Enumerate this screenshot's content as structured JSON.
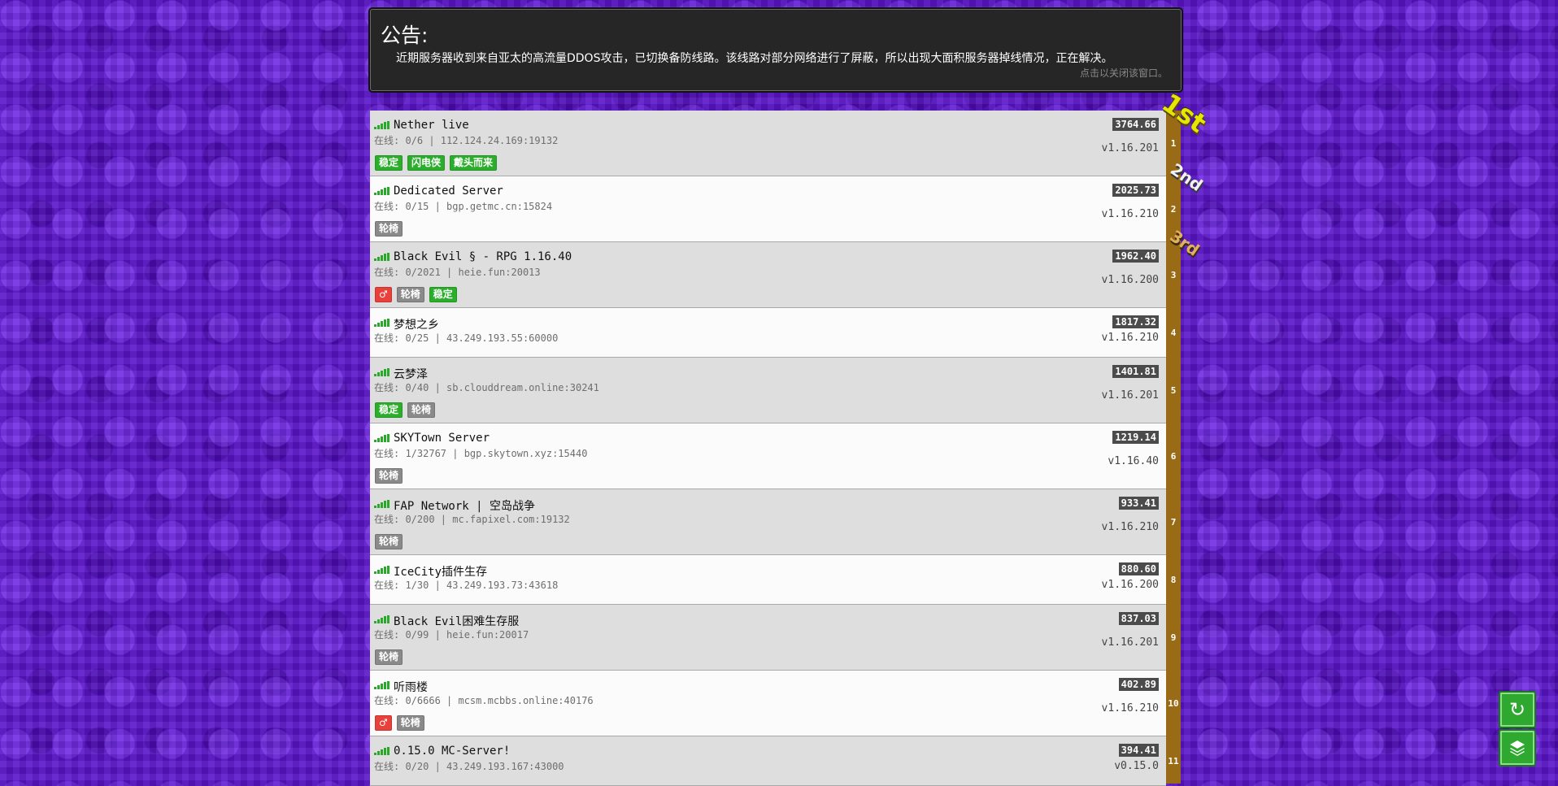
{
  "notice": {
    "title": "公告:",
    "text": "近期服务器收到来自亚太的高流量DDOS攻击，已切换备防线路。该线路对部分网络进行了屏蔽，所以出现大面积服务器掉线情况，正在解决。",
    "close_hint": "点击以关闭该窗口。"
  },
  "medals": {
    "first": "1st",
    "second": "2nd",
    "third": "3rd"
  },
  "servers": [
    {
      "rank": "1",
      "name": "Nether live",
      "online": "在线: 0/6 | 112.124.24.169:19132",
      "score": "3764.66",
      "version": "v1.16.201",
      "tags": [
        [
          "稳定",
          "green"
        ],
        [
          "闪电侠",
          "green"
        ],
        [
          "戴头而来",
          "green"
        ]
      ]
    },
    {
      "rank": "2",
      "name": "Dedicated Server",
      "online": "在线: 0/15 | bgp.getmc.cn:15824",
      "score": "2025.73",
      "version": "v1.16.210",
      "tags": [
        [
          "轮椅",
          "gray"
        ]
      ]
    },
    {
      "rank": "3",
      "name": "Black Evil § - RPG 1.16.40",
      "online": "在线: 0/2021 | heie.fun:20013",
      "score": "1962.40",
      "version": "v1.16.200",
      "tags": [
        [
          "♂",
          "red"
        ],
        [
          "轮椅",
          "gray"
        ],
        [
          "稳定",
          "green"
        ]
      ]
    },
    {
      "rank": "4",
      "name": "梦想之乡",
      "online": "在线: 0/25 | 43.249.193.55:60000",
      "score": "1817.32",
      "version": "v1.16.210",
      "tags": []
    },
    {
      "rank": "5",
      "name": " 云梦泽",
      "online": "在线: 0/40 | sb.clouddream.online:30241",
      "score": "1401.81",
      "version": "v1.16.201",
      "tags": [
        [
          "稳定",
          "green"
        ],
        [
          "轮椅",
          "gray"
        ]
      ]
    },
    {
      "rank": "6",
      "name": "SKYTown Server",
      "online": "在线: 1/32767 | bgp.skytown.xyz:15440",
      "score": "1219.14",
      "version": "v1.16.40",
      "tags": [
        [
          "轮椅",
          "gray"
        ]
      ]
    },
    {
      "rank": "7",
      "name": "FAP Network | 空岛战争",
      "online": "在线: 0/200 | mc.fapixel.com:19132",
      "score": "933.41",
      "version": "v1.16.210",
      "tags": [
        [
          "轮椅",
          "gray"
        ]
      ]
    },
    {
      "rank": "8",
      "name": "IceCity插件生存",
      "online": "在线: 1/30 | 43.249.193.73:43618",
      "score": "880.60",
      "version": "v1.16.200",
      "tags": []
    },
    {
      "rank": "9",
      "name": "Black Evil困难生存服",
      "online": "在线: 0/99 | heie.fun:20017",
      "score": "837.03",
      "version": "v1.16.201",
      "tags": [
        [
          "轮椅",
          "gray"
        ]
      ]
    },
    {
      "rank": "10",
      "name": "听雨楼",
      "online": "在线: 0/6666 | mcsm.mcbbs.online:40176",
      "score": "402.89",
      "version": "v1.16.210",
      "tags": [
        [
          "♂",
          "red"
        ],
        [
          "轮椅",
          "gray"
        ]
      ]
    },
    {
      "rank": "11",
      "name": "0.15.0 MC-Server!",
      "online": "在线: 0/20 | 43.249.193.167:43000",
      "score": "394.41",
      "version": "v0.15.0",
      "tags": []
    }
  ],
  "buttons": {
    "refresh_icon": "refresh-icon",
    "layers_icon": "layers-icon"
  },
  "colors": {
    "tag_green": "#2bae2b",
    "tag_gray": "#8a8a8a",
    "tag_red": "#e8403b",
    "rank_bar": "#9a6b16",
    "fab": "#2ea82e"
  }
}
